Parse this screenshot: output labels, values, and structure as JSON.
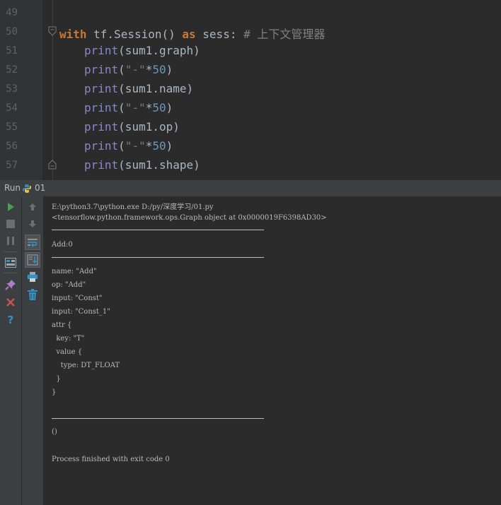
{
  "editor": {
    "line_numbers": [
      "49",
      "50",
      "51",
      "52",
      "53",
      "54",
      "55",
      "56",
      "57"
    ],
    "kw_with": "with",
    "line50_mid": " tf.Session() ",
    "kw_as": "as",
    "line50_var": " sess: ",
    "comment": "# 上下文管理器",
    "print_kw": "print",
    "line51_arg": "(sum1.graph)",
    "line53_arg": "(sum1.name)",
    "line55_arg": "(sum1.op)",
    "line57_arg": "(sum1.shape)",
    "paren_open": "(",
    "dash_str": "\"-\"",
    "star": "*",
    "fifty": "50",
    "paren_close": ")"
  },
  "run": {
    "label": "Run",
    "tab": "01",
    "icons": {
      "play": "play-icon",
      "stop": "stop-icon",
      "pause": "pause-icon",
      "dump": "dump-threads-icon",
      "pin": "pin-icon",
      "close": "close-icon",
      "help": "help-icon",
      "up": "arrow-up-icon",
      "down": "arrow-down-icon",
      "wrap": "soft-wrap-icon",
      "scroll": "scroll-to-end-icon",
      "print": "print-icon",
      "trash": "trash-icon"
    }
  },
  "console": {
    "lines": [
      "E:\\python3.7\\python.exe D:/py/深度学习/01.py",
      "<tensorflow.python.framework.ops.Graph object at 0x0000019F6398AD30>",
      "Add:0",
      "name: \"Add\"",
      "op: \"Add\"",
      "input: \"Const\"",
      "input: \"Const_1\"",
      "attr {",
      "  key: \"T\"",
      "  value {",
      "    type: DT_FLOAT",
      "  }",
      "}",
      "()",
      "Process finished with exit code 0"
    ]
  },
  "colors": {
    "keyword": "#cc7832",
    "builtin": "#8888c6",
    "number": "#6897bb",
    "string": "#6a8759",
    "comment": "#808080",
    "run_green": "#499c54",
    "close_red": "#c75450",
    "help_blue": "#3592c4"
  }
}
